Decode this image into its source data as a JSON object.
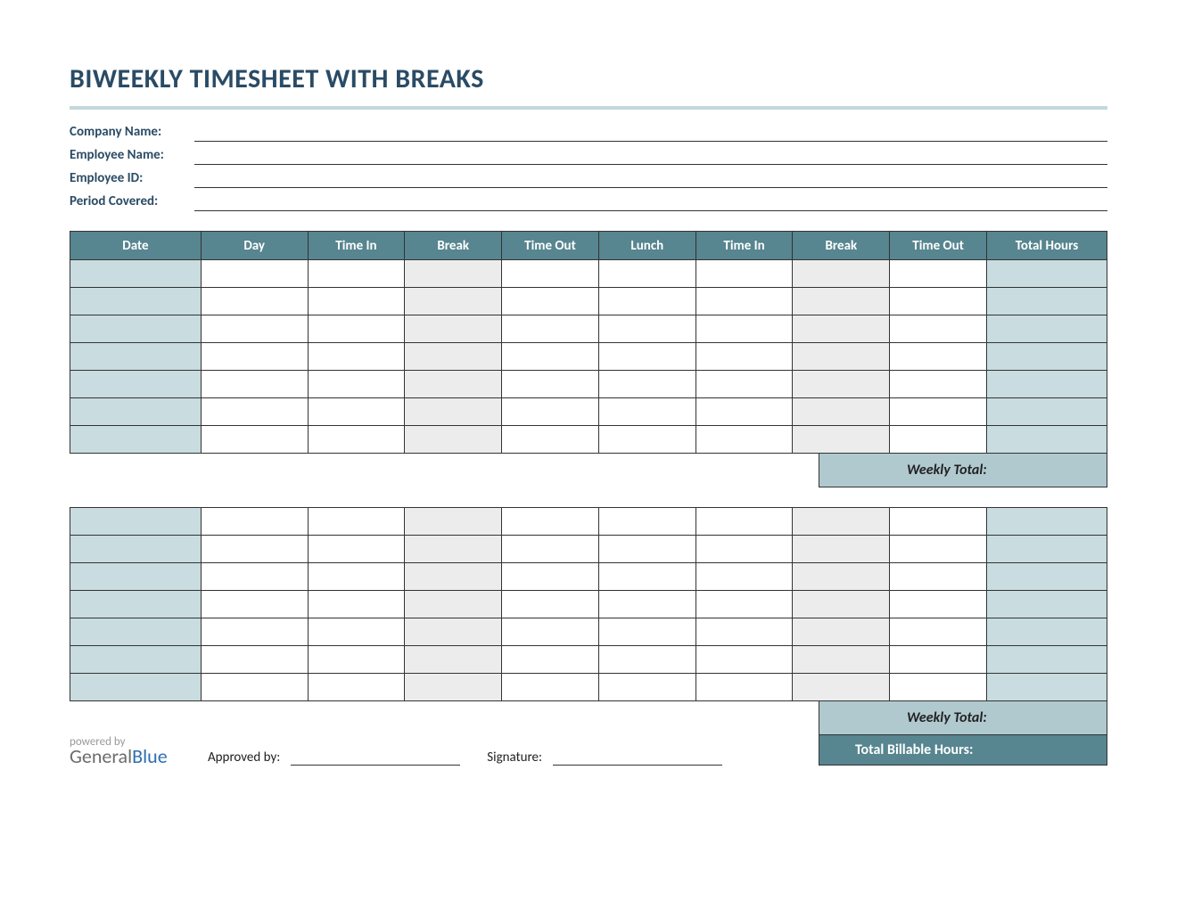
{
  "title": "BIWEEKLY TIMESHEET WITH BREAKS",
  "meta": {
    "company_label": "Company Name:",
    "company_value": "",
    "employee_label": "Employee Name:",
    "employee_value": "",
    "id_label": "Employee ID:",
    "id_value": "",
    "period_label": "Period Covered:",
    "period_value": ""
  },
  "columns": [
    "Date",
    "Day",
    "Time In",
    "Break",
    "Time Out",
    "Lunch",
    "Time In",
    "Break",
    "Time Out",
    "Total Hours"
  ],
  "week1_rows": [
    [
      "",
      "",
      "",
      "",
      "",
      "",
      "",
      "",
      "",
      ""
    ],
    [
      "",
      "",
      "",
      "",
      "",
      "",
      "",
      "",
      "",
      ""
    ],
    [
      "",
      "",
      "",
      "",
      "",
      "",
      "",
      "",
      "",
      ""
    ],
    [
      "",
      "",
      "",
      "",
      "",
      "",
      "",
      "",
      "",
      ""
    ],
    [
      "",
      "",
      "",
      "",
      "",
      "",
      "",
      "",
      "",
      ""
    ],
    [
      "",
      "",
      "",
      "",
      "",
      "",
      "",
      "",
      "",
      ""
    ],
    [
      "",
      "",
      "",
      "",
      "",
      "",
      "",
      "",
      "",
      ""
    ]
  ],
  "week2_rows": [
    [
      "",
      "",
      "",
      "",
      "",
      "",
      "",
      "",
      "",
      ""
    ],
    [
      "",
      "",
      "",
      "",
      "",
      "",
      "",
      "",
      "",
      ""
    ],
    [
      "",
      "",
      "",
      "",
      "",
      "",
      "",
      "",
      "",
      ""
    ],
    [
      "",
      "",
      "",
      "",
      "",
      "",
      "",
      "",
      "",
      ""
    ],
    [
      "",
      "",
      "",
      "",
      "",
      "",
      "",
      "",
      "",
      ""
    ],
    [
      "",
      "",
      "",
      "",
      "",
      "",
      "",
      "",
      "",
      ""
    ],
    [
      "",
      "",
      "",
      "",
      "",
      "",
      "",
      "",
      "",
      ""
    ]
  ],
  "weekly_total_label": "Weekly Total:",
  "weekly_total_1": "",
  "weekly_total_2": "",
  "footer": {
    "powered_by": "powered by",
    "brand_1": "General",
    "brand_2": "Blue",
    "approved_label": "Approved by:",
    "approved_value": "",
    "signature_label": "Signature:",
    "signature_value": "",
    "billable_label": "Total Billable Hours:",
    "billable_value": ""
  }
}
